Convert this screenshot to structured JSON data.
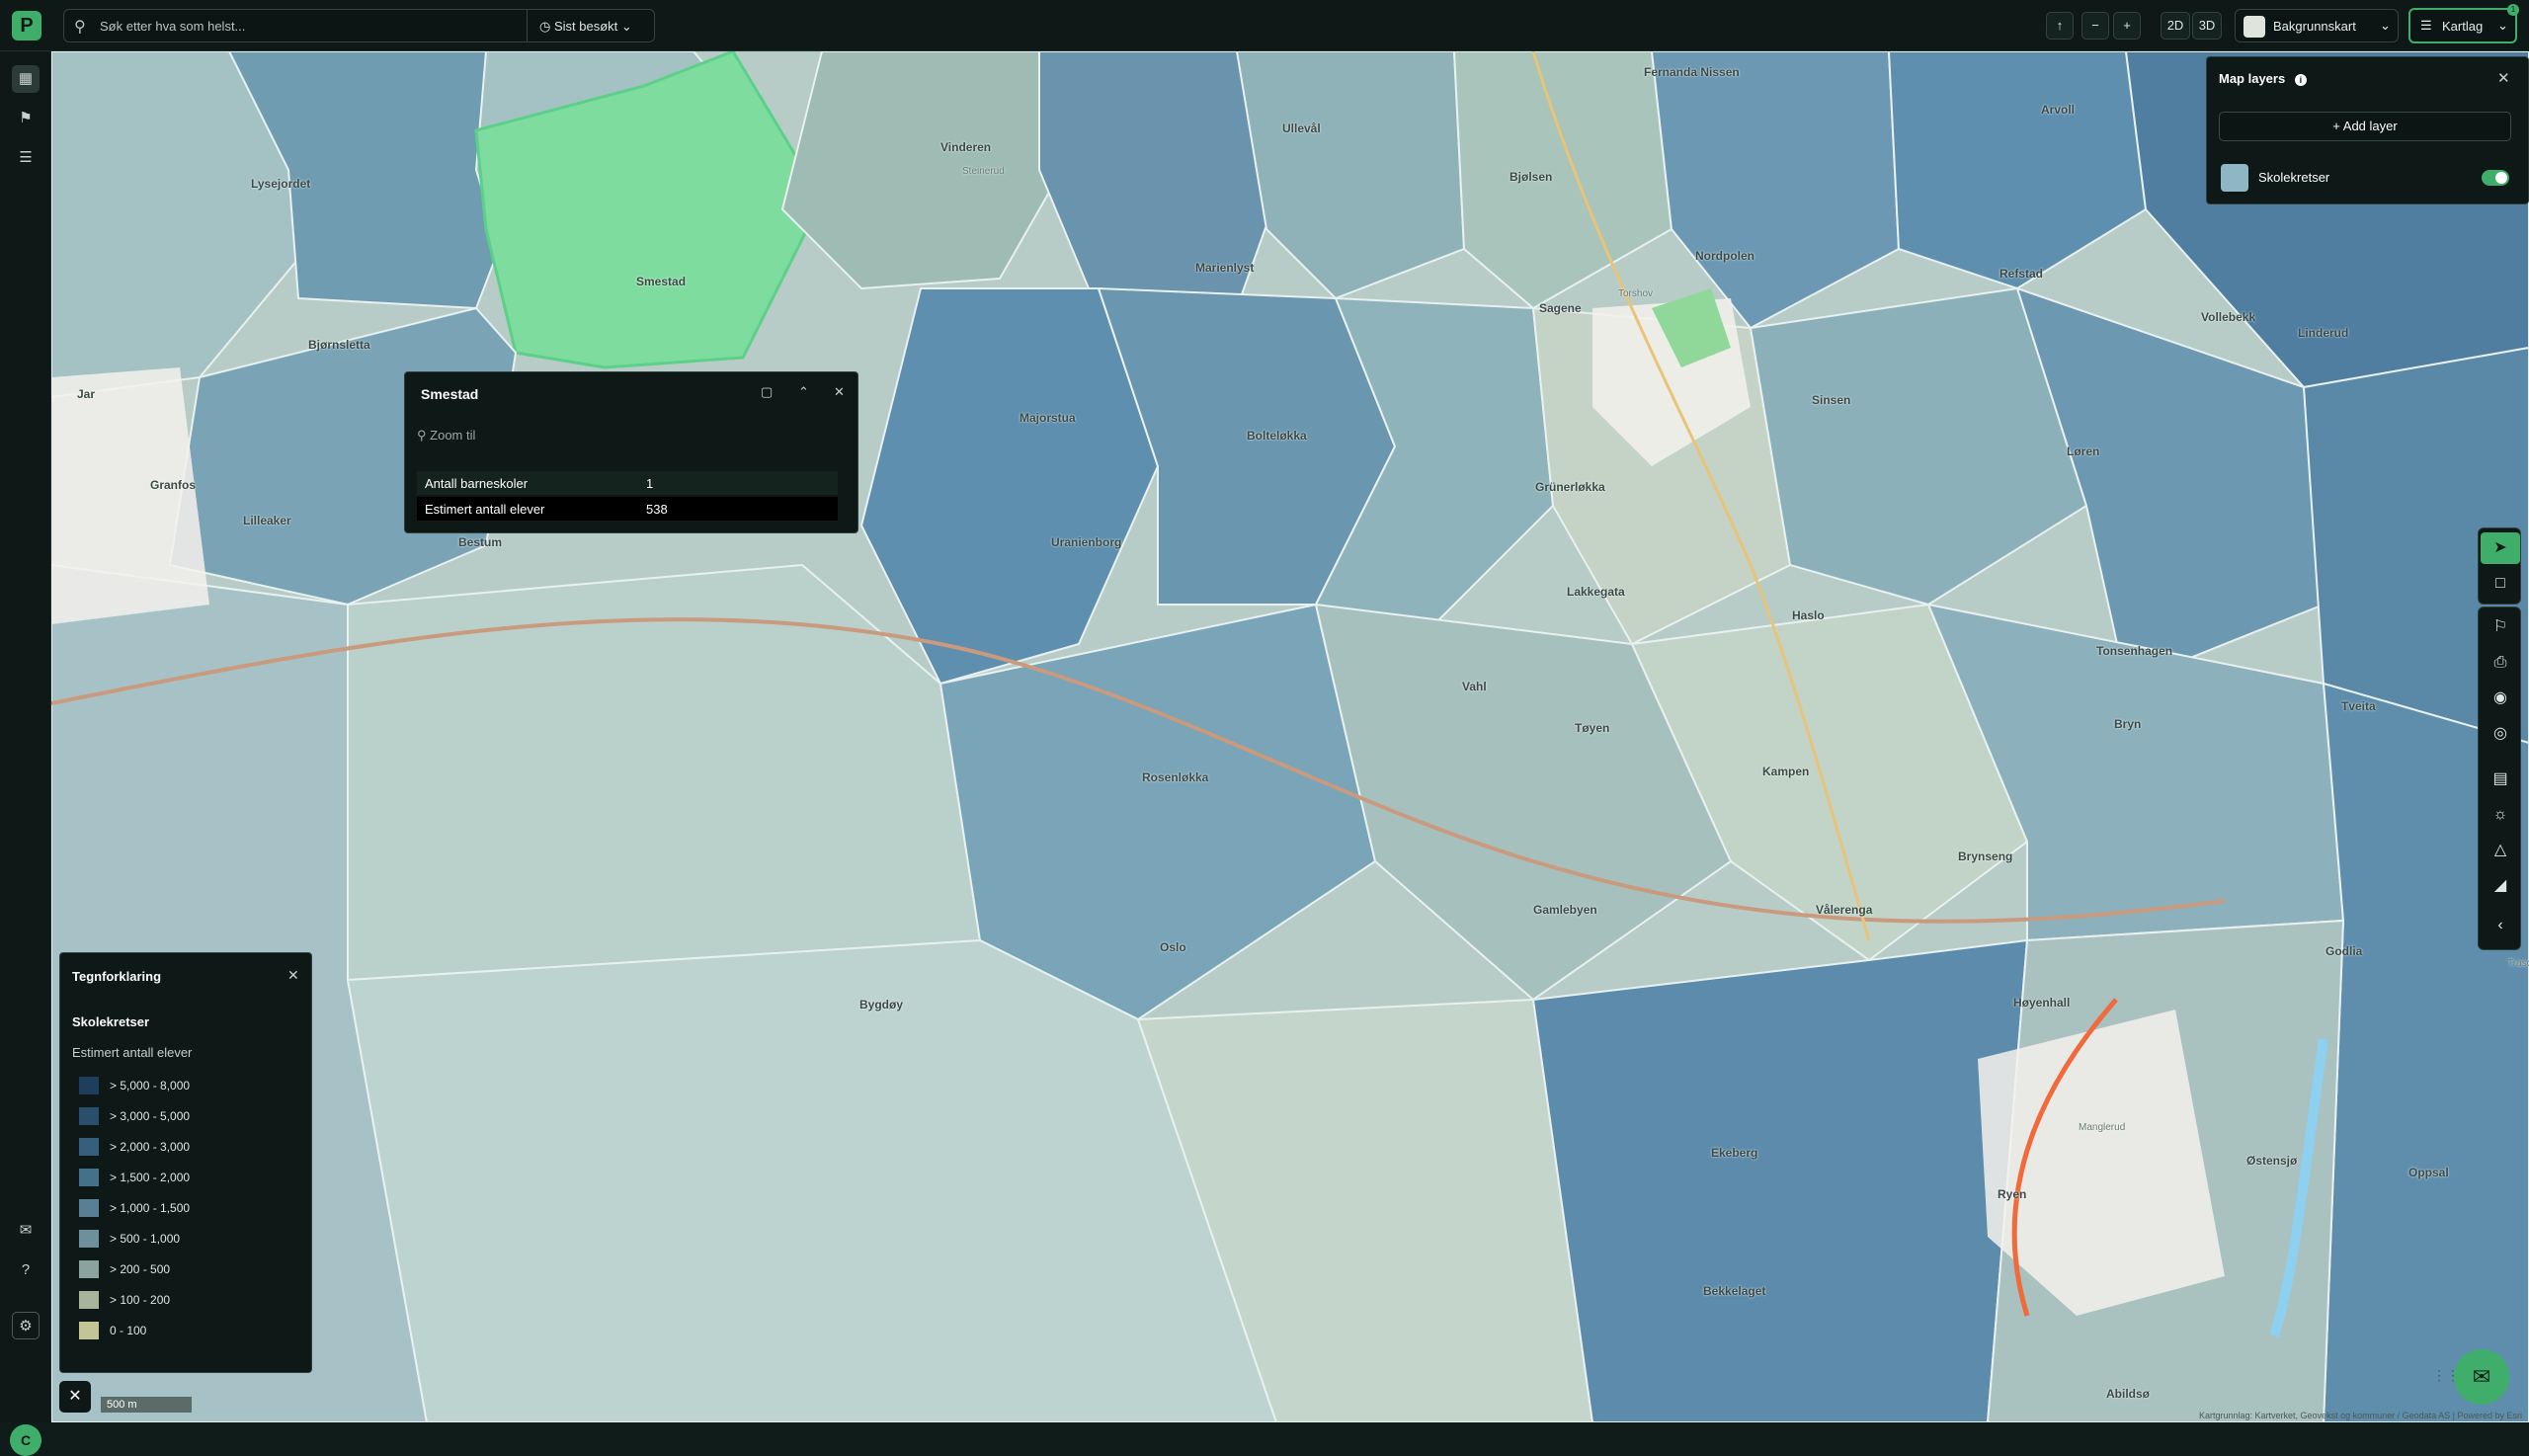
{
  "app": {
    "logo_letter": "P"
  },
  "search": {
    "placeholder": "Søk etter hva som helst...",
    "recent_label": "Sist besøkt"
  },
  "toolbar": {
    "zoom_out": "−",
    "zoom_in": "+",
    "view_2d": "2D",
    "view_3d": "3D",
    "basemap_label": "Bakgrunnskart",
    "layers_label": "Kartlag",
    "layers_badge": "1"
  },
  "sidebar": {
    "user_initial": "C"
  },
  "popup": {
    "title": "Smestad",
    "zoom_label": "Zoom til",
    "rows": [
      {
        "key": "Antall barneskoler",
        "value": "1"
      },
      {
        "key": "Estimert antall elever",
        "value": "538"
      }
    ]
  },
  "layers_panel": {
    "title": "Map layers",
    "add_label": "Add layer",
    "items": [
      {
        "name": "Skolekretser",
        "enabled": true
      }
    ]
  },
  "legend": {
    "title": "Tegnforklaring",
    "layer": "Skolekretser",
    "field": "Estimert antall elever",
    "classes": [
      {
        "label": "> 5,000 - 8,000",
        "color": "#1f3d5c"
      },
      {
        "label": "> 3,000 - 5,000",
        "color": "#2a4f6d"
      },
      {
        "label": "> 2,000 - 3,000",
        "color": "#355f7c"
      },
      {
        "label": "> 1,500 - 2,000",
        "color": "#45708a"
      },
      {
        "label": "> 1,000 - 1,500",
        "color": "#587f93"
      },
      {
        "label": "> 500 - 1,000",
        "color": "#6e909c"
      },
      {
        "label": "> 200 - 500",
        "color": "#8aa39f"
      },
      {
        "label": "> 100 - 200",
        "color": "#a6b59c"
      },
      {
        "label": "0 - 100",
        "color": "#c4c596"
      }
    ]
  },
  "scale": {
    "label": "500 m"
  },
  "attribution": "Kartgrunnlag: Kartverket, Geovekst og kommuner / Geodata AS | Powered by Esri",
  "map_labels": [
    "Smestad",
    "Vinderen",
    "Ullevål",
    "Fernanda Nissen",
    "Arvoll",
    "Lysejordet",
    "Steinerud",
    "Marienlyst",
    "Bjølsen",
    "Sagene",
    "Torshov",
    "Nordpolen",
    "Refstad",
    "Vollebekk",
    "Linderud",
    "Bjørnsletta",
    "Majorstua",
    "Bolteløkka",
    "Sinsen",
    "Løren",
    "Jar",
    "Granfos",
    "Lilleaker",
    "Bestum",
    "Uranienborg",
    "Grünerløkka",
    "Lakkegata",
    "Haslo",
    "Tonsenhagen",
    "Vahl",
    "Tøyen",
    "Rosenløkka",
    "Kampen",
    "Bryn",
    "Tveita",
    "Brynseng",
    "Gamlebyen",
    "Vålerenga",
    "Oslo",
    "Bygdøy",
    "Høyenhall",
    "Manglerud",
    "Ryen",
    "Ekeberg",
    "Bekkelaget",
    "Godlia",
    "Oppsal",
    "Abildsø",
    "Østensjø",
    "Trasop"
  ],
  "colors": {
    "accent": "#3fae6a",
    "panel_bg": "#0e1917",
    "selected_district": "#7fdc9f"
  }
}
